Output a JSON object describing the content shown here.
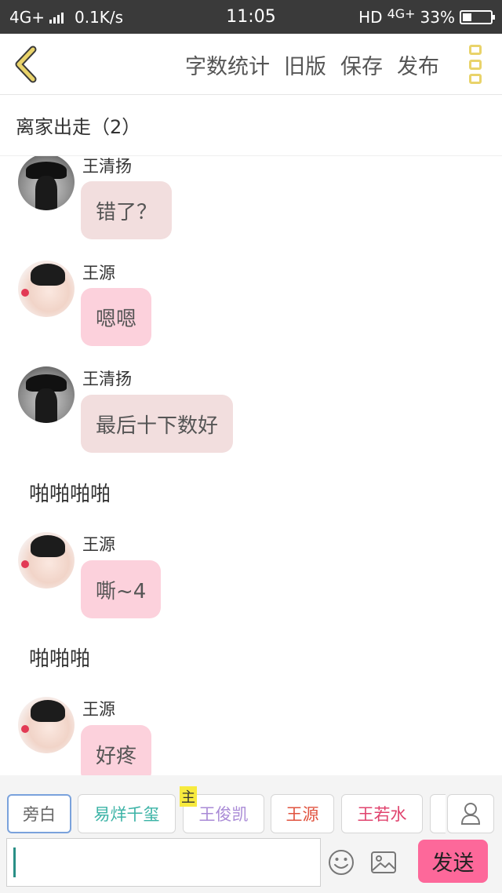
{
  "status_bar": {
    "network": "4G+",
    "speed": "0.1K/s",
    "time": "11:05",
    "hd": "HD",
    "network_right": "4G+",
    "battery": "33%",
    "battery_level": 0.33
  },
  "header": {
    "back_icon": "chevron-left-icon",
    "actions": [
      "字数统计",
      "旧版",
      "保存",
      "发布"
    ],
    "more_icon": "more-vertical-icon",
    "accent_color": "#e9d36a"
  },
  "chapter": {
    "title": "离家出走（2）"
  },
  "messages": [
    {
      "type": "chat",
      "sender": "王清扬",
      "text": "错了？",
      "avatar": "avatar-hat"
    },
    {
      "type": "chat",
      "sender": "王源",
      "text": "嗯嗯",
      "avatar": "avatar-boy"
    },
    {
      "type": "chat",
      "sender": "王清扬",
      "text": "最后十下数好",
      "avatar": "avatar-hat"
    },
    {
      "type": "narration",
      "text": "啪啪啪啪"
    },
    {
      "type": "chat",
      "sender": "王源",
      "text": "嘶~4",
      "avatar": "avatar-boy"
    },
    {
      "type": "narration",
      "text": "啪啪啪"
    },
    {
      "type": "chat",
      "sender": "王源",
      "text": "好疼",
      "avatar": "avatar-boy"
    }
  ],
  "roles": [
    {
      "label": "旁白",
      "color": "#666666"
    },
    {
      "label": "易烊千玺",
      "color": "#3bb3a6"
    },
    {
      "label": "王俊凯",
      "color": "#a98ad6"
    },
    {
      "label": "王源",
      "color": "#e0533f"
    },
    {
      "label": "王若水",
      "color": "#e0436e"
    }
  ],
  "host_badge": "主",
  "input": {
    "value": "",
    "placeholder": ""
  },
  "send_label": "发送",
  "send_color": "#fd689a"
}
